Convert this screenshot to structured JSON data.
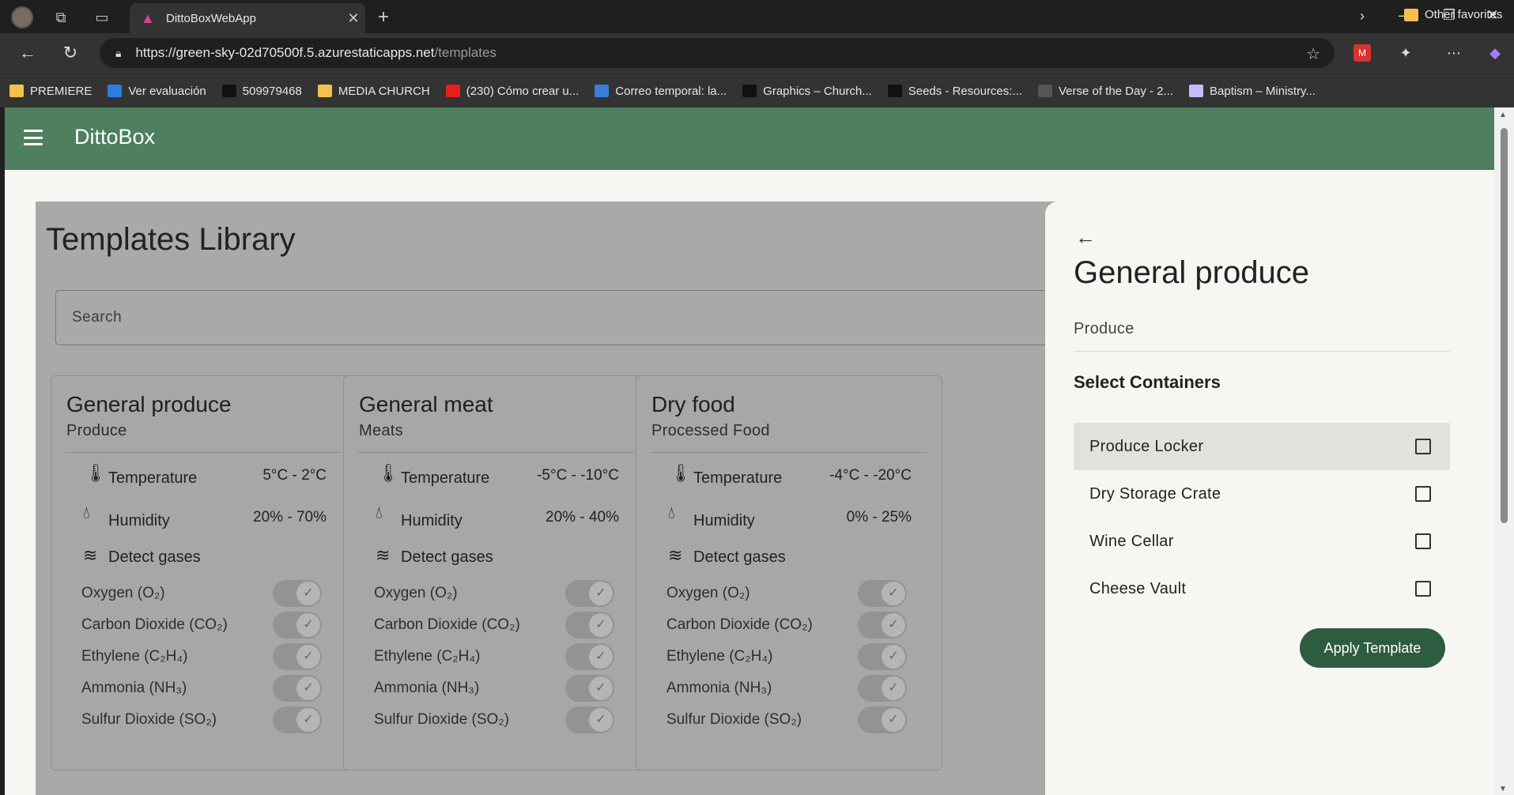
{
  "browser": {
    "tab_title": "DittoBoxWebApp",
    "url_host": "https://green-sky-02d70500f.5.azurestaticapps.net",
    "url_path": "/templates",
    "bookmarks": [
      {
        "label": "PREMIERE",
        "icon": "folder-icon",
        "color": "#f2c14e"
      },
      {
        "label": "Ver evaluación",
        "icon": "app-icon",
        "color": "#2a7de1"
      },
      {
        "label": "509979468",
        "icon": "bb-icon",
        "color": "#111111"
      },
      {
        "label": "MEDIA CHURCH",
        "icon": "folder-icon",
        "color": "#f2c14e"
      },
      {
        "label": "(230) Cómo crear u...",
        "icon": "youtube-icon",
        "color": "#e62117"
      },
      {
        "label": "Correo temporal: la...",
        "icon": "mail-icon",
        "color": "#3c7dd9"
      },
      {
        "label": "Graphics – Church...",
        "icon": "circle-icon",
        "color": "#111111"
      },
      {
        "label": "Seeds - Resources:...",
        "icon": "globe-icon",
        "color": "#111111"
      },
      {
        "label": "Verse of the Day - 2...",
        "icon": "bible-icon",
        "color": "#555555"
      },
      {
        "label": "Baptism – Ministry...",
        "icon": "page-icon",
        "color": "#c9b9ff"
      }
    ],
    "other_favorites": "Other favorites"
  },
  "app": {
    "title": "DittoBox"
  },
  "library": {
    "title": "Templates Library",
    "search_placeholder": "Search",
    "cards": [
      {
        "name": "General produce",
        "category": "Produce",
        "temperature_label": "Temperature",
        "temperature_value": "5°C - 2°C",
        "humidity_label": "Humidity",
        "humidity_value": "20% - 70%",
        "gases_label": "Detect gases",
        "gases": [
          "Oxygen (O₂)",
          "Carbon Dioxide (CO₂)",
          "Ethylene (C₂H₄)",
          "Ammonia (NH₃)",
          "Sulfur Dioxide (SO₂)"
        ]
      },
      {
        "name": "General meat",
        "category": "Meats",
        "temperature_label": "Temperature",
        "temperature_value": "-5°C - -10°C",
        "humidity_label": "Humidity",
        "humidity_value": "20% - 40%",
        "gases_label": "Detect gases",
        "gases": [
          "Oxygen (O₂)",
          "Carbon Dioxide (CO₂)",
          "Ethylene (C₂H₄)",
          "Ammonia (NH₃)",
          "Sulfur Dioxide (SO₂)"
        ]
      },
      {
        "name": "Dry food",
        "category": "Processed Food",
        "temperature_label": "Temperature",
        "temperature_value": "-4°C - -20°C",
        "humidity_label": "Humidity",
        "humidity_value": "0% - 25%",
        "gases_label": "Detect gases",
        "gases": [
          "Oxygen (O₂)",
          "Carbon Dioxide (CO₂)",
          "Ethylene (C₂H₄)",
          "Ammonia (NH₃)",
          "Sulfur Dioxide (SO₂)"
        ]
      }
    ]
  },
  "drawer": {
    "title": "General produce",
    "category": "Produce",
    "select_label": "Select Containers",
    "containers": [
      "Produce Locker",
      "Dry Storage Crate",
      "Wine Cellar",
      "Cheese Vault"
    ],
    "apply_label": "Apply Template"
  },
  "colors": {
    "appbar": "#4e7f5e",
    "apply_button": "#2e5c40",
    "overlay": "#a9a9a8"
  }
}
